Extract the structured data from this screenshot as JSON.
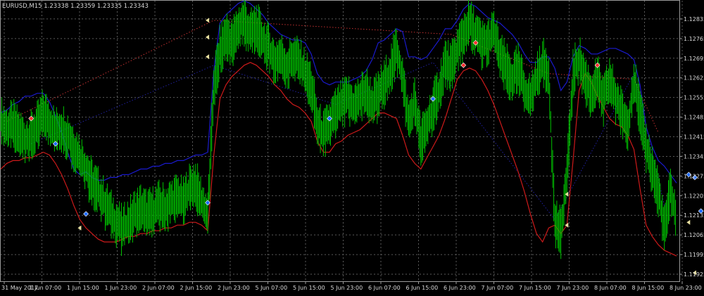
{
  "header": {
    "symbol_line": "EURUSD,M15  1.23338 1.23359 1.23335 1.23343"
  },
  "colors": {
    "background": "#000000",
    "grid": "#5a5a5a",
    "price_bars": "#00c000",
    "upper_band": "#1a1acc",
    "lower_band": "#cc1a1a",
    "dotted_upper": "#c03030",
    "dotted_lower": "#2020a0",
    "axis_text": "#d8d8d8",
    "marker_blue": "#1e6bff",
    "marker_red": "#ff3030",
    "marker_yellow": "#e8e0a0"
  },
  "chart_data": {
    "type": "line",
    "title": "EURUSD,M15  1.23338 1.23359 1.23335 1.23343",
    "xlabel": "",
    "ylabel": "",
    "ylim": [
      1.119,
      1.129
    ],
    "grid": true,
    "x_ticks": [
      "31 May 2017",
      "1 Jun 07:00",
      "1 Jun 15:00",
      "1 Jun 23:00",
      "2 Jun 07:00",
      "2 Jun 15:00",
      "2 Jun 23:00",
      "5 Jun 07:00",
      "5 Jun 15:00",
      "5 Jun 23:00",
      "6 Jun 07:00",
      "6 Jun 15:00",
      "6 Jun 23:00",
      "7 Jun 07:00",
      "7 Jun 15:00",
      "7 Jun 23:00",
      "8 Jun 07:00",
      "8 Jun 15:00",
      "8 Jun 23:00"
    ],
    "y_ticks": [
      "1.12835",
      "1.12765",
      "1.12695",
      "1.12625",
      "1.12555",
      "1.12485",
      "1.12415",
      "1.12345",
      "1.12275",
      "1.12205",
      "1.12135",
      "1.12065",
      "1.11995",
      "1.11925"
    ],
    "series": [
      {
        "key": "price",
        "values": [
          1.1247,
          1.1244,
          1.1246,
          1.1243,
          1.124,
          1.1242,
          1.1245,
          1.125,
          1.1247,
          1.1243,
          1.1245,
          1.1242,
          1.1238,
          1.1234,
          1.123,
          1.1225,
          1.1222,
          1.1218,
          1.1214,
          1.1211,
          1.1208,
          1.1211,
          1.1214,
          1.1216,
          1.1214,
          1.1215,
          1.1217,
          1.1216,
          1.1218,
          1.122,
          1.1218,
          1.1223,
          1.1225,
          1.1218,
          1.1213,
          1.126,
          1.1272,
          1.1278,
          1.1275,
          1.128,
          1.1283,
          1.1278,
          1.1281,
          1.1276,
          1.1273,
          1.1268,
          1.127,
          1.1266,
          1.127,
          1.1268,
          1.1264,
          1.126,
          1.1246,
          1.1242,
          1.1246,
          1.125,
          1.1253,
          1.1255,
          1.1252,
          1.1255,
          1.1258,
          1.1253,
          1.1256,
          1.126,
          1.1265,
          1.1273,
          1.1262,
          1.1246,
          1.1254,
          1.124,
          1.1245,
          1.1252,
          1.1258,
          1.1268,
          1.1266,
          1.1272,
          1.1278,
          1.1282,
          1.1278,
          1.1274,
          1.1275,
          1.1278,
          1.127,
          1.1266,
          1.1262,
          1.1266,
          1.1258,
          1.1255,
          1.1262,
          1.1268,
          1.1264,
          1.1212,
          1.1207,
          1.1228,
          1.1264,
          1.1269,
          1.1262,
          1.1257,
          1.1262,
          1.1254,
          1.1262,
          1.1255,
          1.125,
          1.1245,
          1.1262,
          1.125,
          1.1238,
          1.123,
          1.1222,
          1.1208,
          1.1222,
          1.1212
        ]
      },
      {
        "key": "upper",
        "values": [
          1.125,
          1.1251,
          1.1253,
          1.1254,
          1.1256,
          1.1256,
          1.1257,
          1.1257,
          1.1254,
          1.1249,
          1.1243,
          1.1236,
          1.123,
          1.1228,
          1.1229,
          1.1227,
          1.1226,
          1.1226,
          1.1227,
          1.1227,
          1.1228,
          1.1228,
          1.1229,
          1.123,
          1.123,
          1.1231,
          1.1231,
          1.1232,
          1.1232,
          1.1233,
          1.1233,
          1.1234,
          1.1235,
          1.1235,
          1.1236,
          1.1265,
          1.1282,
          1.1285,
          1.1287,
          1.1289,
          1.129,
          1.1289,
          1.1287,
          1.1285,
          1.1282,
          1.128,
          1.1278,
          1.1277,
          1.1276,
          1.1276,
          1.1275,
          1.1271,
          1.1264,
          1.1261,
          1.126,
          1.1261,
          1.1261,
          1.1261,
          1.1262,
          1.1263,
          1.1265,
          1.1269,
          1.1275,
          1.1276,
          1.1278,
          1.128,
          1.1279,
          1.127,
          1.127,
          1.1269,
          1.127,
          1.1273,
          1.1276,
          1.128,
          1.128,
          1.1283,
          1.1287,
          1.1289,
          1.1288,
          1.1286,
          1.1284,
          1.1283,
          1.1282,
          1.128,
          1.1278,
          1.1275,
          1.1271,
          1.1268,
          1.1268,
          1.127,
          1.127,
          1.1266,
          1.1258,
          1.1261,
          1.127,
          1.1274,
          1.1273,
          1.1271,
          1.1271,
          1.1272,
          1.1273,
          1.1273,
          1.1272,
          1.1271,
          1.1269,
          1.126,
          1.1245,
          1.1238,
          1.1233,
          1.1231,
          1.1228,
          1.1225
        ]
      },
      {
        "key": "lower",
        "values": [
          1.123,
          1.1232,
          1.1233,
          1.1233,
          1.1234,
          1.1234,
          1.1235,
          1.1236,
          1.1235,
          1.1232,
          1.1228,
          1.1223,
          1.1217,
          1.1212,
          1.1209,
          1.1207,
          1.1205,
          1.1204,
          1.1204,
          1.1204,
          1.1205,
          1.1206,
          1.1206,
          1.1207,
          1.1207,
          1.1208,
          1.1208,
          1.1209,
          1.1209,
          1.121,
          1.121,
          1.1211,
          1.1211,
          1.121,
          1.1208,
          1.1235,
          1.1255,
          1.126,
          1.1263,
          1.1265,
          1.1267,
          1.1268,
          1.1267,
          1.1265,
          1.1263,
          1.126,
          1.1258,
          1.1255,
          1.1253,
          1.1252,
          1.125,
          1.1247,
          1.124,
          1.1236,
          1.1236,
          1.1239,
          1.124,
          1.1242,
          1.1243,
          1.1244,
          1.1246,
          1.1248,
          1.125,
          1.125,
          1.1249,
          1.1248,
          1.1242,
          1.1235,
          1.1232,
          1.123,
          1.1234,
          1.1238,
          1.1242,
          1.1248,
          1.1255,
          1.1262,
          1.1265,
          1.1266,
          1.1265,
          1.1262,
          1.1258,
          1.1253,
          1.1247,
          1.1241,
          1.1235,
          1.1229,
          1.1222,
          1.1214,
          1.1207,
          1.1204,
          1.1209,
          1.121,
          1.1207,
          1.121,
          1.1233,
          1.1258,
          1.1264,
          1.1261,
          1.1256,
          1.1252,
          1.1248,
          1.1246,
          1.1245,
          1.1242,
          1.1237,
          1.1223,
          1.121,
          1.1206,
          1.1203,
          1.1201,
          1.12,
          1.1199
        ]
      }
    ],
    "dotted_lines": [
      {
        "color_key": "dotted_upper",
        "points": [
          [
            1,
            1.1247
          ],
          [
            35,
            1.1283
          ],
          [
            74,
            1.1278
          ],
          [
            90,
            1.1264
          ],
          [
            104,
            1.1262
          ],
          [
            108,
            1.1243
          ]
        ]
      },
      {
        "color_key": "dotted_lower",
        "points": [
          [
            5,
            1.1239
          ],
          [
            35,
            1.1267
          ],
          [
            55,
            1.1253
          ],
          [
            71,
            1.1268
          ],
          [
            91,
            1.1212
          ],
          [
            104,
            1.1264
          ],
          [
            109,
            1.1217
          ]
        ]
      }
    ],
    "markers": [
      {
        "i": 5,
        "price": 1.1248,
        "color_key": "marker_red"
      },
      {
        "i": 9,
        "price": 1.1239,
        "color_key": "marker_blue"
      },
      {
        "i": 14,
        "price": 1.1214,
        "color_key": "marker_blue"
      },
      {
        "i": 34,
        "price": 1.1218,
        "color_key": "marker_blue"
      },
      {
        "i": 54,
        "price": 1.1248,
        "color_key": "marker_blue"
      },
      {
        "i": 71,
        "price": 1.1255,
        "color_key": "marker_blue"
      },
      {
        "i": 76,
        "price": 1.1267,
        "color_key": "marker_red"
      },
      {
        "i": 78,
        "price": 1.1275,
        "color_key": "marker_red"
      },
      {
        "i": 98,
        "price": 1.1267,
        "color_key": "marker_red"
      },
      {
        "i": 113,
        "price": 1.1228,
        "color_key": "marker_blue"
      },
      {
        "i": 114,
        "price": 1.1227,
        "color_key": "marker_blue"
      },
      {
        "i": 115,
        "price": 1.1215,
        "color_key": "marker_blue"
      }
    ],
    "arrow_markers": [
      {
        "i": 13,
        "price": 1.1209
      },
      {
        "i": 34,
        "price": 1.1283
      },
      {
        "i": 34,
        "price": 1.1277
      },
      {
        "i": 34,
        "price": 1.127
      },
      {
        "i": 93,
        "price": 1.1221
      },
      {
        "i": 93,
        "price": 1.121
      },
      {
        "i": 113,
        "price": 1.1211
      },
      {
        "i": 114,
        "price": 1.1193
      }
    ]
  }
}
